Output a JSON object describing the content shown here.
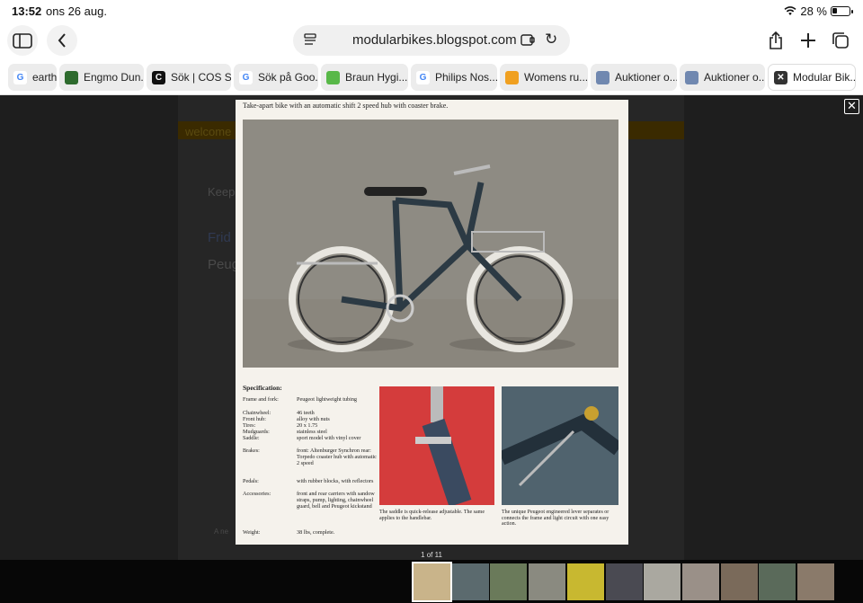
{
  "status_bar": {
    "time": "13:52",
    "date": "ons 26 aug.",
    "battery": "28 %",
    "battery_level": 0.28
  },
  "toolbar": {
    "url": "modularbikes.blogspot.com"
  },
  "tabs": [
    {
      "label": "earth",
      "fav": "G",
      "color": "#ffffff"
    },
    {
      "label": "Engmo Dun...",
      "fav": "",
      "color": "#2e6b2e"
    },
    {
      "label": "Sök | COS SE",
      "fav": "C",
      "color": "#111111"
    },
    {
      "label": "Sök på Goo...",
      "fav": "G",
      "color": "#ffffff"
    },
    {
      "label": "Braun Hygi...",
      "fav": "",
      "color": "#58b848"
    },
    {
      "label": "Philips Nos...",
      "fav": "G",
      "color": "#ffffff"
    },
    {
      "label": "Womens ru...",
      "fav": "",
      "color": "#f0a020"
    },
    {
      "label": "Auktioner o...",
      "fav": "",
      "color": "#7088b0"
    },
    {
      "label": "Auktioner o...",
      "fav": "",
      "color": "#7088b0"
    },
    {
      "label": "Modular Bik...",
      "fav": "✕",
      "color": "#333333"
    }
  ],
  "background_blog": {
    "texts": [
      "welcome",
      "Keep",
      "Frid",
      "Peug",
      "A ne"
    ]
  },
  "viewer": {
    "heading": "Take-apart bike with an automatic shift 2 speed hub with coaster brake.",
    "spec_title": "Specification:",
    "specs": [
      {
        "k": "Frame and fork:",
        "v": "Peugeot lightweight tubing"
      },
      {
        "k": "Chainwheel:",
        "v": "46 teeth"
      },
      {
        "k": "Front hub:",
        "v": "alloy with nuts"
      },
      {
        "k": "Tires:",
        "v": "20 x 1.75"
      },
      {
        "k": "Mudguards:",
        "v": "stainless steel"
      },
      {
        "k": "Saddle:",
        "v": "sport model with vinyl cover"
      },
      {
        "k": "Brakes:",
        "v": "front: Altenburger Synchron rear: Torpedo coaster hub with automatic 2 speed"
      },
      {
        "k": "Pedals:",
        "v": "with rubber blocks, with reflectors"
      },
      {
        "k": "Accessories:",
        "v": "front and rear carriers with sandow straps, pump, lighting, chainwheel guard, bell and Peugeot kickstand"
      },
      {
        "k": "Weight:",
        "v": "38 lbs, complete."
      }
    ],
    "caption1": "The saddle is quick-release adjustable. The same applies to the handlebar.",
    "caption2": "The unique Peugeot engineered lever separates or connects the frame and light circuit with one easy action.",
    "counter": "1 of 11"
  },
  "thumbnails": [
    {
      "color": "#c9b48a"
    },
    {
      "color": "#5b6a6e"
    },
    {
      "color": "#6a7a5a"
    },
    {
      "color": "#8a8a80"
    },
    {
      "color": "#c8b830"
    },
    {
      "color": "#4a4a52"
    },
    {
      "color": "#aaa8a0"
    },
    {
      "color": "#9a9088"
    },
    {
      "color": "#7a6a5a"
    },
    {
      "color": "#5a6a5a"
    },
    {
      "color": "#8a7a6a"
    }
  ]
}
